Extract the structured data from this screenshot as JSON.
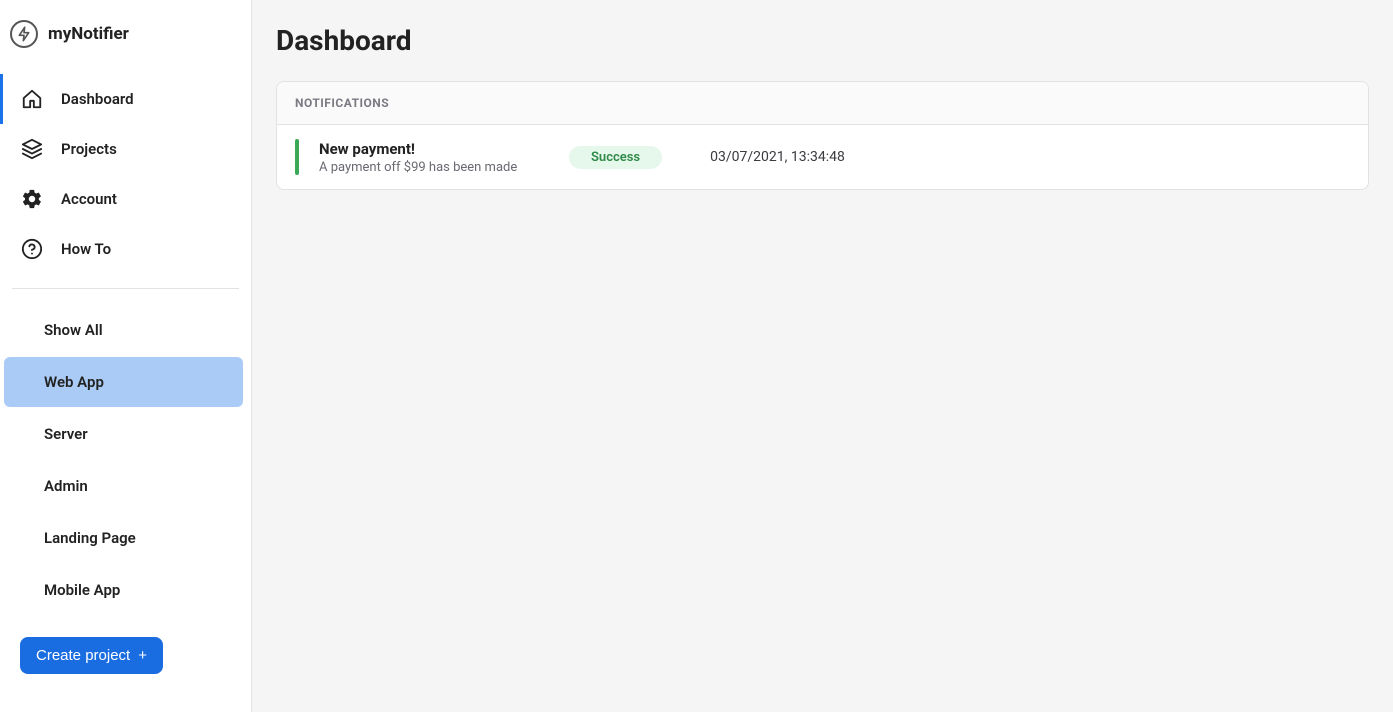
{
  "brand": "myNotifier",
  "nav": [
    {
      "id": "dashboard",
      "label": "Dashboard",
      "icon": "home",
      "active": true
    },
    {
      "id": "projects",
      "label": "Projects",
      "icon": "layers",
      "active": false
    },
    {
      "id": "account",
      "label": "Account",
      "icon": "gear",
      "active": false
    },
    {
      "id": "howto",
      "label": "How To",
      "icon": "help",
      "active": false
    }
  ],
  "projects": [
    {
      "id": "showall",
      "label": "Show All",
      "selected": false
    },
    {
      "id": "webapp",
      "label": "Web App",
      "selected": true
    },
    {
      "id": "server",
      "label": "Server",
      "selected": false
    },
    {
      "id": "admin",
      "label": "Admin",
      "selected": false
    },
    {
      "id": "landing",
      "label": "Landing Page",
      "selected": false
    },
    {
      "id": "mobile",
      "label": "Mobile App",
      "selected": false
    }
  ],
  "create_button": "Create project",
  "page_title": "Dashboard",
  "card_header": "NOTIFICATIONS",
  "notifications": [
    {
      "title": "New payment!",
      "description": "A payment off $99 has been made",
      "badge": "Success",
      "status_color": "#3aa956",
      "timestamp": "03/07/2021, 13:34:48"
    }
  ]
}
